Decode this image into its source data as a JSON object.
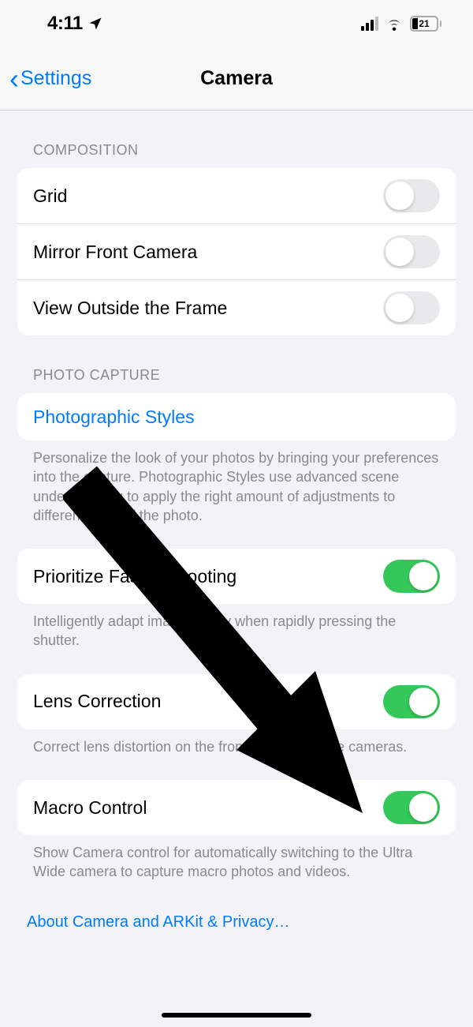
{
  "status": {
    "time": "4:11",
    "battery_pct": "21"
  },
  "header": {
    "back_label": "Settings",
    "title": "Camera"
  },
  "sections": {
    "composition": {
      "header": "COMPOSITION",
      "items": {
        "grid": {
          "label": "Grid",
          "on": false
        },
        "mirror": {
          "label": "Mirror Front Camera",
          "on": false
        },
        "view_outside": {
          "label": "View Outside the Frame",
          "on": false
        }
      }
    },
    "photo_capture": {
      "header": "PHOTO CAPTURE",
      "photographic_styles": {
        "label": "Photographic Styles"
      },
      "photographic_styles_footer": "Personalize the look of your photos by bringing your preferences into the capture. Photographic Styles use advanced scene understanding to apply the right amount of adjustments to different parts of the photo.",
      "prioritize": {
        "label": "Prioritize Faster Shooting",
        "on": true
      },
      "prioritize_footer": "Intelligently adapt image quality when rapidly pressing the shutter.",
      "lens_correction": {
        "label": "Lens Correction",
        "on": true
      },
      "lens_correction_footer": "Correct lens distortion on the front and Ultra Wide cameras.",
      "macro_control": {
        "label": "Macro Control",
        "on": true
      },
      "macro_control_footer": "Show Camera control for automatically switching to the Ultra Wide camera to capture macro photos and videos."
    }
  },
  "privacy_link": "About Camera and ARKit & Privacy…"
}
